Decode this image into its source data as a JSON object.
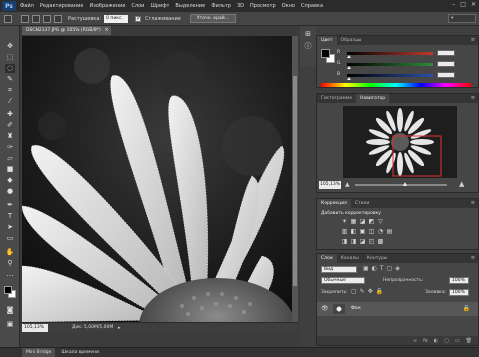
{
  "app": {
    "logo": "Ps"
  },
  "menu": [
    "Файл",
    "Редактирование",
    "Изображение",
    "Слои",
    "Шрифт",
    "Выделение",
    "Фильтр",
    "3D",
    "Просмотр",
    "Окно",
    "Справка"
  ],
  "window_controls": [
    "–",
    "□",
    "✕"
  ],
  "options": {
    "feather_label": "Растушевка:",
    "feather_value": "0 пикс.",
    "antialias_label": "Сглаживание",
    "refine_button": "Уточн. край..."
  },
  "document": {
    "tab_title": "DSCN2137.JPG @ 105% (RGB/8*)",
    "close": "×",
    "zoom": "105,13%",
    "info": "Док: 5,00M/5,00M",
    "status_arrow": "▸"
  },
  "bottom_tabs": [
    "Mini Bridge",
    "Шкала времени"
  ],
  "color_panel": {
    "tabs": [
      "Цвет",
      "Образцы"
    ],
    "channels": [
      {
        "label": "R",
        "value": "",
        "track": "#c0392b"
      },
      {
        "label": "G",
        "value": "",
        "track": "#2e8b3a"
      },
      {
        "label": "B",
        "value": "",
        "track": "#2d4fa8"
      }
    ],
    "menu": "≡"
  },
  "navigator_panel": {
    "tabs": [
      "Гистограмма",
      "Навигатор"
    ],
    "zoom": "105,13%",
    "menu": "≡"
  },
  "corrections_panel": {
    "tabs": [
      "Коррекция",
      "Стили"
    ],
    "title": "Добавить корректировку",
    "icons_row1": [
      "☀",
      "▦",
      "◪",
      "◩",
      "▽"
    ],
    "icons_row2": [
      "▥",
      "◧",
      "▣",
      "◫",
      "◔",
      "▤"
    ],
    "icons_row3": [
      "◨",
      "◨",
      "◪",
      "◰",
      "▩"
    ],
    "menu": "≡"
  },
  "layers_panel": {
    "tabs": [
      "Слои",
      "Каналы",
      "Контуры"
    ],
    "kind_label": "Вид",
    "blend_mode": "Обычные",
    "opacity_label": "Непрозрачность:",
    "opacity_value": "100%",
    "lock_label": "Закрепить:",
    "fill_label": "Заливка:",
    "fill_value": "100%",
    "layer_name": "Фон",
    "footer_icons": [
      "∞",
      "fx",
      "◐",
      "▢",
      "▭",
      "🗑"
    ],
    "menu": "≡"
  },
  "colors": {
    "accent": "#1b3e6b",
    "panel": "#464646",
    "menubar": "#2b2b2b"
  }
}
